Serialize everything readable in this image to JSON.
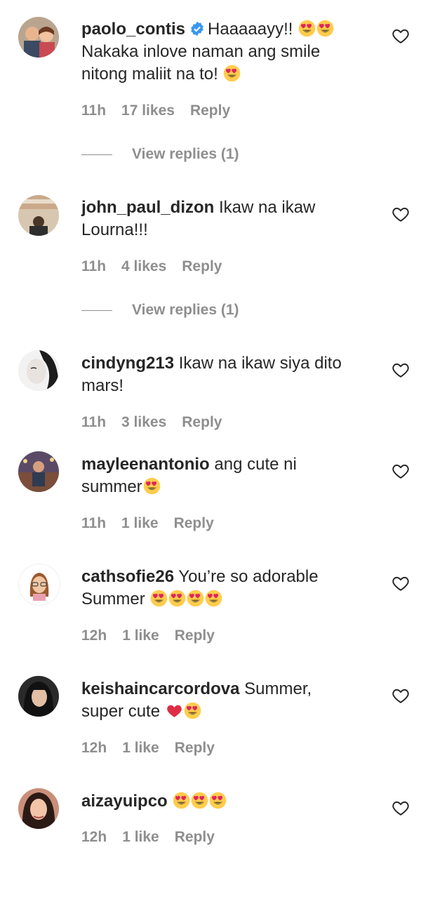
{
  "comments": [
    {
      "username": "paolo_contis",
      "verified": true,
      "text_lines": [
        "Haaaaayy!!",
        "Nakaka inlove naman ang smile",
        "nitong maliit na to!"
      ],
      "time": "11h",
      "likes": "17 likes",
      "reply": "Reply",
      "view_replies": "View replies (1)"
    },
    {
      "username": "john_paul_dizon",
      "text_lines": [
        "Ikaw na ikaw",
        "Lourna!!!"
      ],
      "time": "11h",
      "likes": "4 likes",
      "reply": "Reply",
      "view_replies": "View replies (1)"
    },
    {
      "username": "cindyng213",
      "text_lines": [
        "Ikaw na ikaw siya dito",
        "mars!"
      ],
      "time": "11h",
      "likes": "3 likes",
      "reply": "Reply"
    },
    {
      "username": "mayleenantonio",
      "text_lines": [
        "ang cute ni",
        "summer"
      ],
      "time": "11h",
      "likes": "1 like",
      "reply": "Reply"
    },
    {
      "username": "cathsofie26",
      "text_lines": [
        "You’re so adorable",
        "Summer"
      ],
      "time": "12h",
      "likes": "1 like",
      "reply": "Reply"
    },
    {
      "username": "keishaincarcordova",
      "text_lines": [
        "Summer,",
        "super cute"
      ],
      "time": "12h",
      "likes": "1 like",
      "reply": "Reply"
    },
    {
      "username": "aizayuipco",
      "text_lines": [
        ""
      ],
      "time": "12h",
      "likes": "1 like",
      "reply": "Reply"
    }
  ],
  "icons": {
    "like": "heart-outline-icon",
    "verified": "verified-badge-icon",
    "emoji": "heart-eyes-emoji"
  },
  "colors": {
    "text": "#262626",
    "meta": "#8e8e8e",
    "verified": "#3897f0",
    "emoji_face": "#ffcc4d",
    "emoji_heart": "#e0245e"
  }
}
